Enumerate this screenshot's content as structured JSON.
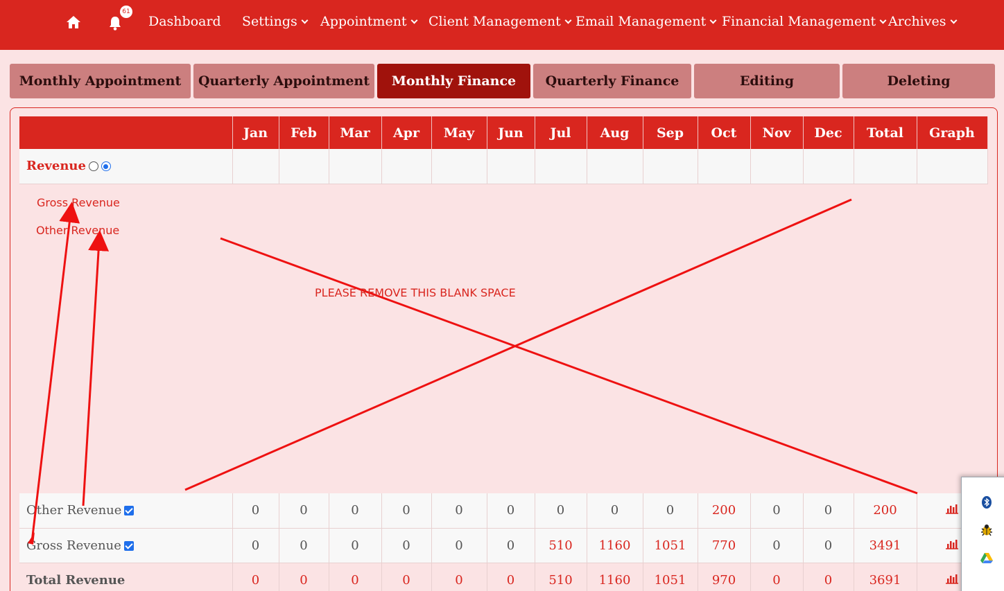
{
  "nav": {
    "badge_count": "61",
    "items": [
      {
        "label": "Dashboard",
        "dropdown": false
      },
      {
        "label": "Settings",
        "dropdown": true
      },
      {
        "label": "Appointment",
        "dropdown": true
      },
      {
        "label": "Client Management",
        "dropdown": true
      },
      {
        "label": "Email Management",
        "dropdown": true
      },
      {
        "label": "Financial Management",
        "dropdown": true
      },
      {
        "label": "Archives",
        "dropdown": true
      }
    ]
  },
  "tabs": [
    {
      "label": "Monthly Appointment",
      "active": false
    },
    {
      "label": "Quarterly Appointment",
      "active": false
    },
    {
      "label": "Monthly Finance",
      "active": true
    },
    {
      "label": "Quarterly Finance",
      "active": false
    },
    {
      "label": "Editing",
      "active": false
    },
    {
      "label": "Deleting",
      "active": false
    }
  ],
  "table": {
    "columns": [
      "Jan",
      "Feb",
      "Mar",
      "Apr",
      "May",
      "Jun",
      "Jul",
      "Aug",
      "Sep",
      "Oct",
      "Nov",
      "Dec",
      "Total",
      "Graph"
    ],
    "revenue_label": "Revenue",
    "dropdown_options": [
      "Gross Revenue",
      "Other Revenue"
    ],
    "rows": [
      {
        "label": "Other Revenue",
        "checked": true,
        "values": [
          "0",
          "0",
          "0",
          "0",
          "0",
          "0",
          "0",
          "0",
          "0",
          "200",
          "0",
          "0",
          "200"
        ]
      },
      {
        "label": "Gross Revenue",
        "checked": true,
        "values": [
          "0",
          "0",
          "0",
          "0",
          "0",
          "0",
          "510",
          "1160",
          "1051",
          "770",
          "0",
          "0",
          "3491"
        ]
      },
      {
        "label": "Total Revenue",
        "checked": false,
        "values": [
          "0",
          "0",
          "0",
          "0",
          "0",
          "0",
          "510",
          "1160",
          "1051",
          "970",
          "0",
          "0",
          "3691"
        ]
      }
    ]
  },
  "annotation": {
    "text": "PLEASE REMOVE THIS BLANK SPACE",
    "color": "#ee1111"
  },
  "colors": {
    "brand_red": "#d9261f",
    "active_tab": "#a0120c",
    "tab_bg": "#cc7f7f",
    "panel_bg": "#fbe3e4"
  },
  "tray": {
    "icons": [
      "bluetooth-icon",
      "bug-icon",
      "google-drive-icon"
    ]
  }
}
